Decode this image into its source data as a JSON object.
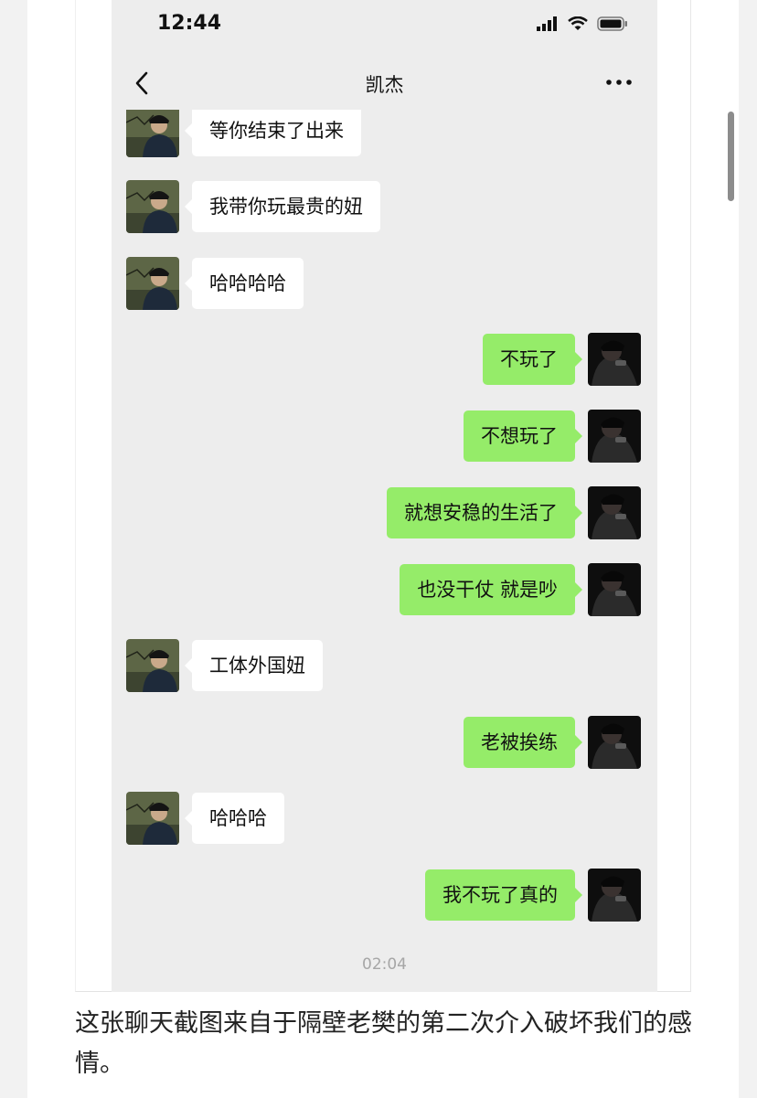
{
  "status_bar": {
    "time": "12:44"
  },
  "nav": {
    "title": "凯杰"
  },
  "messages": [
    {
      "side": "left",
      "text": "等你结束了出来"
    },
    {
      "side": "left",
      "text": "我带你玩最贵的妞"
    },
    {
      "side": "left",
      "text": "哈哈哈哈"
    },
    {
      "side": "right",
      "text": "不玩了"
    },
    {
      "side": "right",
      "text": "不想玩了"
    },
    {
      "side": "right",
      "text": "就想安稳的生活了"
    },
    {
      "side": "right",
      "text": "也没干仗 就是吵"
    },
    {
      "side": "left",
      "text": "工体外国妞"
    },
    {
      "side": "right",
      "text": "老被挨练"
    },
    {
      "side": "left",
      "text": "哈哈哈"
    },
    {
      "side": "right",
      "text": "我不玩了真的"
    }
  ],
  "timestamp": "02:04",
  "caption": "这张聊天截图来自于隔壁老樊的第二次介入破坏我们的感情。",
  "colors": {
    "chat_background": "#ededed",
    "incoming_bubble": "#ffffff",
    "outgoing_bubble": "#95ec69"
  }
}
